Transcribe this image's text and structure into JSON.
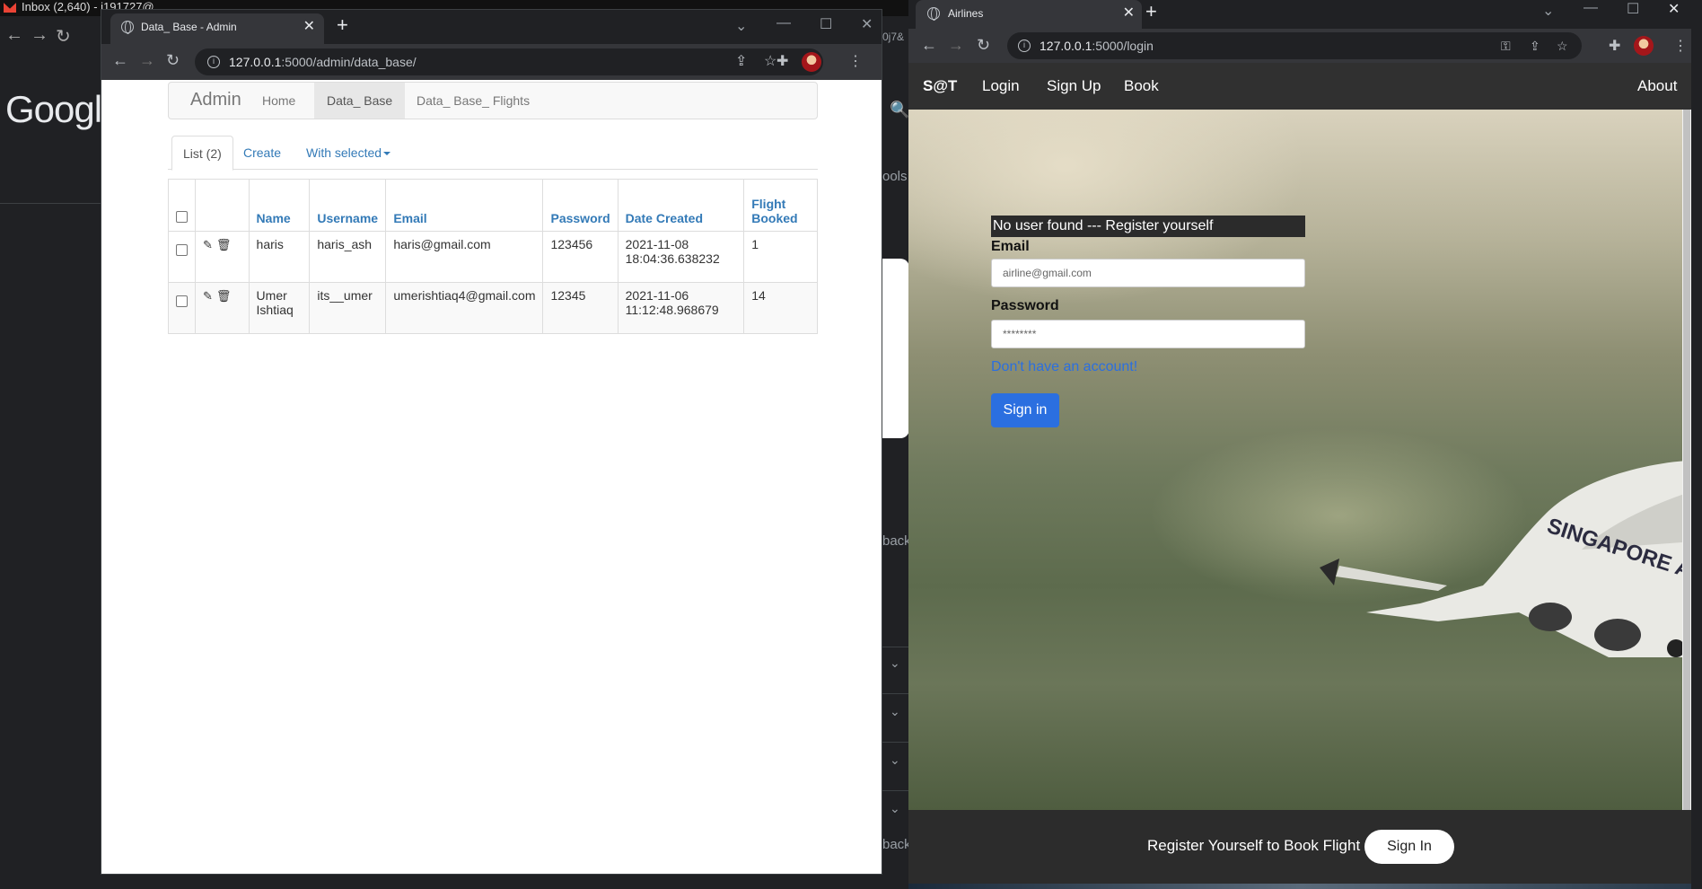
{
  "background": {
    "tab_title": "Inbox (2,640) - i191727@...",
    "google_text": "Google",
    "fragments": [
      "0j7&",
      "ools",
      "back",
      "back"
    ]
  },
  "admin_window": {
    "tab_title": "Data_ Base - Admin",
    "url_host": "127.0.0.1",
    "url_rest": ":5000/admin/data_base/",
    "navbar": {
      "brand": "Admin",
      "links": [
        "Home",
        "Data_ Base",
        "Data_ Base_ Flights"
      ]
    },
    "tabs": {
      "list": "List (2)",
      "create": "Create",
      "with_selected": "With selected"
    },
    "table": {
      "headers": [
        "Name",
        "Username",
        "Email",
        "Password",
        "Date Created",
        "Flight Booked"
      ],
      "rows": [
        {
          "name": "haris",
          "username": "haris_ash",
          "email": "haris@gmail.com",
          "password": "123456",
          "date_created": "2021-11-08 18:04:36.638232",
          "flight_booked": "1"
        },
        {
          "name": "Umer Ishtiaq",
          "username": "its__umer",
          "email": "umerishtiaq4@gmail.com",
          "password": "12345",
          "date_created": "2021-11-06 11:12:48.968679",
          "flight_booked": "14"
        }
      ]
    }
  },
  "airlines_window": {
    "tab_title": "Airlines",
    "url_host": "127.0.0.1",
    "url_rest": ":5000/login",
    "nav": {
      "logo": "S@T",
      "links": [
        "Login",
        "Sign Up",
        "Book"
      ],
      "about": "About"
    },
    "alert": "No user found --- Register yourself",
    "form": {
      "email_label": "Email",
      "email_placeholder": "airline@gmail.com",
      "password_label": "Password",
      "password_placeholder": "********",
      "no_account_link": "Don't have an account!",
      "sign_in": "Sign in"
    },
    "plane_text": "SINGAPORE A",
    "footer": {
      "text": "Register Yourself to Book Flight",
      "button": "Sign In"
    }
  },
  "colors": {
    "link_blue": "#337ab7",
    "primary_button": "#2b6fe0",
    "chrome_dark": "#202124",
    "chrome_toolbar": "#35363a"
  }
}
